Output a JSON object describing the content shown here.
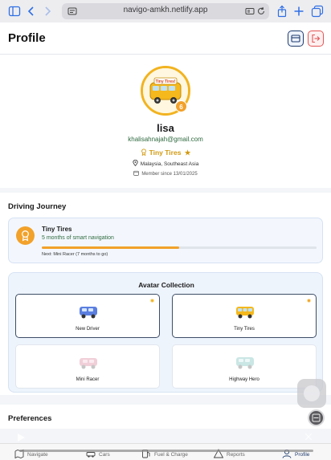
{
  "browser": {
    "url": "navigo-amkh.netlify.app"
  },
  "header": {
    "title": "Profile"
  },
  "profile": {
    "username": "lisa",
    "email": "khalisahnajah@gmail.com",
    "rank": "Tiny Tires",
    "rank_star": "★",
    "level_badge": "6",
    "location": "Malaysia, Southeast Asia",
    "member_since": "Member since 13/01/2025",
    "avatar_sign": "Tiny Tires!"
  },
  "journey": {
    "section_title": "Driving Journey",
    "rank_title": "Tiny Tires",
    "subtitle": "5 months of smart navigation",
    "progress": 0.5,
    "next": "Next: Mini Racer (7 months to go)"
  },
  "collection": {
    "title": "Avatar Collection",
    "avatars": [
      {
        "label": "New Driver",
        "unlocked": true,
        "color": "#4b6fd9"
      },
      {
        "label": "Tiny Tires",
        "unlocked": true,
        "color": "#f2b320"
      },
      {
        "label": "Mini Racer",
        "unlocked": false,
        "color": "#e7a9bb"
      },
      {
        "label": "Highway Hero",
        "unlocked": false,
        "color": "#9fd3d0"
      }
    ]
  },
  "preferences": {
    "section_title": "Preferences"
  },
  "nav": {
    "items": [
      {
        "label": "Navigate",
        "icon": "map-icon"
      },
      {
        "label": "Cars",
        "icon": "car-icon"
      },
      {
        "label": "Fuel & Charge",
        "icon": "fuel-icon"
      },
      {
        "label": "Reports",
        "icon": "warning-icon"
      },
      {
        "label": "Profile",
        "icon": "user-icon"
      }
    ]
  },
  "colors": {
    "accent": "#f2a12a",
    "brand_dark": "#1f3b6b",
    "logout": "#e25656",
    "email_green": "#2f6a3f"
  }
}
